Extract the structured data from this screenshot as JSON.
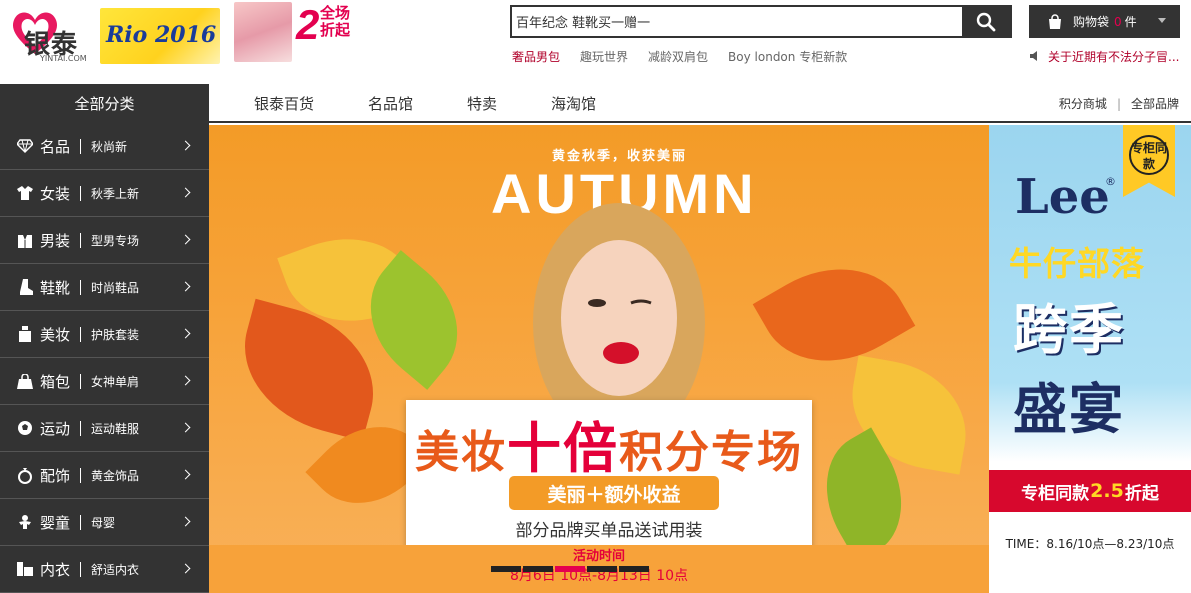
{
  "header": {
    "logo_cn": "银泰",
    "logo_en": "YINTAI.COM",
    "event_logo": "Rio 2016",
    "promo_number": "2",
    "promo_text_1": "全场",
    "promo_text_2": "折起"
  },
  "search": {
    "value": "百年纪念 鞋靴买一赠一",
    "button_icon": "search-icon"
  },
  "hot_words": [
    "奢品男包",
    "趣玩世界",
    "减龄双肩包",
    "Boy london 专柜新款"
  ],
  "cart": {
    "label": "购物袋",
    "count": "0",
    "unit": "件"
  },
  "notice": "关于近期有不法分子冒...",
  "nav": {
    "all_categories": "全部分类",
    "links": [
      "银泰百货",
      "名品馆",
      "特卖",
      "海淘馆"
    ],
    "right_links": [
      "积分商城",
      "全部品牌"
    ],
    "separator": "|"
  },
  "categories": [
    {
      "name": "名品",
      "sub": "秋尚新",
      "icon": "diamond-icon"
    },
    {
      "name": "女装",
      "sub": "秋季上新",
      "icon": "womens-shirt-icon"
    },
    {
      "name": "男装",
      "sub": "型男专场",
      "icon": "mens-suit-icon"
    },
    {
      "name": "鞋靴",
      "sub": "时尚鞋品",
      "icon": "boot-icon"
    },
    {
      "name": "美妆",
      "sub": "护肤套装",
      "icon": "cosmetics-icon"
    },
    {
      "name": "箱包",
      "sub": "女神单肩",
      "icon": "handbag-icon"
    },
    {
      "name": "运动",
      "sub": "运动鞋服",
      "icon": "ball-icon"
    },
    {
      "name": "配饰",
      "sub": "黄金饰品",
      "icon": "ring-icon"
    },
    {
      "name": "婴童",
      "sub": "母婴",
      "icon": "baby-icon"
    },
    {
      "name": "内衣",
      "sub": "舒适内衣",
      "icon": "underwear-icon"
    }
  ],
  "banner": {
    "tagline": "黄金秋季，收获美丽",
    "autumn": "AUTUMN",
    "headline_pre": "美妆",
    "headline_em": "十倍",
    "headline_post": "积分专场",
    "pill": "美丽＋额外收益",
    "sub": "部分品牌买单品送试用装",
    "time_label": "活动时间",
    "time_range": "8月6日 10点-8月13日 10点",
    "slide_count": 5,
    "active_slide": 3
  },
  "side_ad": {
    "badge": "专柜同款",
    "brand": "Lee",
    "reg": "®",
    "tribe": "牛仔部落",
    "cross": "跨季",
    "feast": "盛宴",
    "deal_pre": "专柜同款",
    "deal_num": "2.5",
    "deal_suffix": "折起",
    "time": "TIME：8.16/10点—8.23/10点"
  },
  "colors": {
    "dark": "#333333",
    "accent": "#e5004f",
    "banner_orange": "#f39b27",
    "notice_red": "#b0002a"
  }
}
